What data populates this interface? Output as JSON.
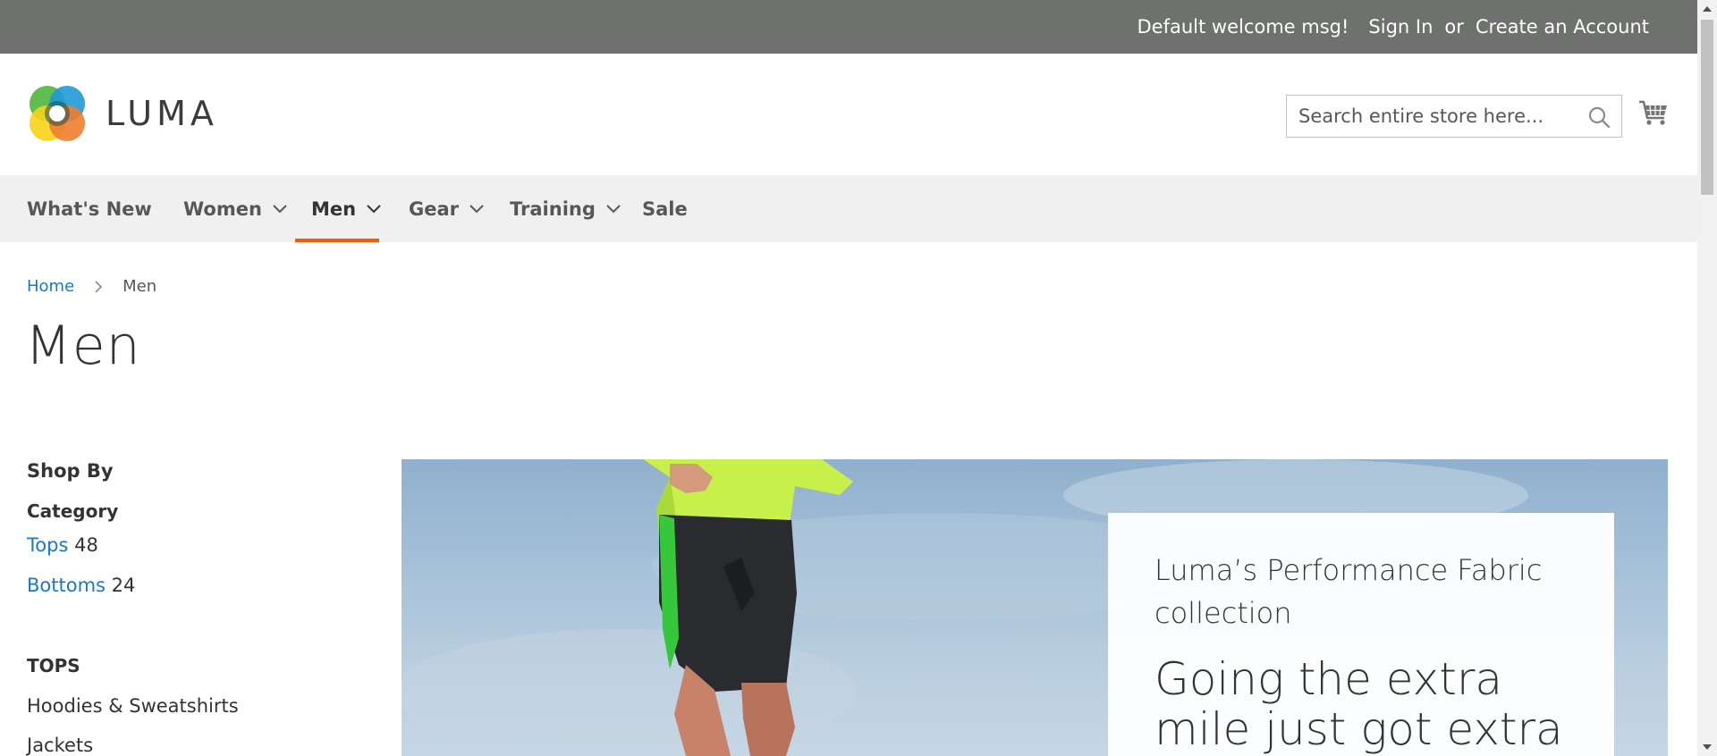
{
  "panel": {
    "welcome": "Default welcome msg!",
    "sign_in": "Sign In",
    "or": "or",
    "create_account": "Create an Account"
  },
  "header": {
    "logo_text": "LUMA",
    "search_placeholder": "Search entire store here...",
    "icons": [
      "search-icon",
      "cart-icon"
    ]
  },
  "nav": {
    "items": [
      {
        "label": "What's New",
        "has_dropdown": false
      },
      {
        "label": "Women",
        "has_dropdown": true
      },
      {
        "label": "Men",
        "has_dropdown": true,
        "active": true
      },
      {
        "label": "Gear",
        "has_dropdown": true
      },
      {
        "label": "Training",
        "has_dropdown": true
      },
      {
        "label": "Sale",
        "has_dropdown": false
      }
    ],
    "active_color": "#ff5501"
  },
  "breadcrumb": {
    "home": "Home",
    "current": "Men"
  },
  "page_title": "Men",
  "sidebar": {
    "shop_by": "Shop By",
    "category_title": "Category",
    "filters": [
      {
        "label": "Tops",
        "count": "48"
      },
      {
        "label": "Bottoms",
        "count": "24"
      }
    ],
    "tops_title": "TOPS",
    "tops_links": [
      "Hoodies & Sweatshirts",
      "Jackets"
    ]
  },
  "promo": {
    "subtitle": "Luma’s Performance Fabric collection",
    "headline": "Going the extra mile just got extra"
  },
  "colors": {
    "panel_bg": "#6e716e",
    "link": "#1979c3",
    "nav_bg": "#f0f0f0"
  }
}
